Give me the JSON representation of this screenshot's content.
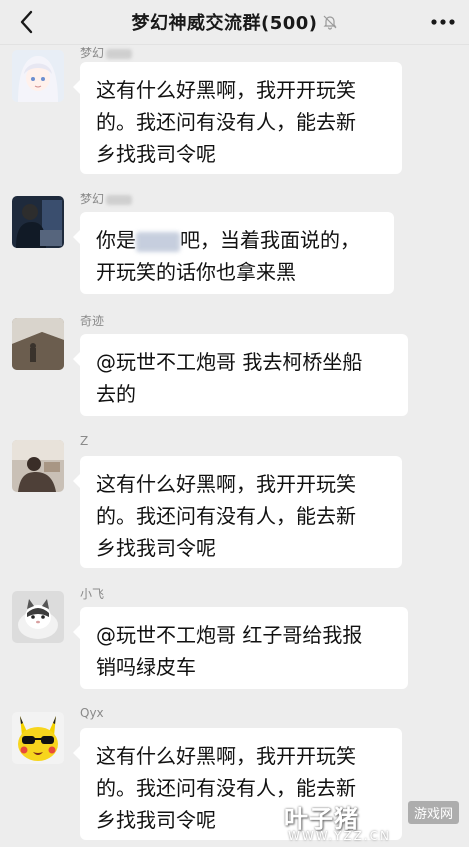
{
  "header": {
    "title": "梦幻神威交流群(500)",
    "back_icon": "chevron-left-icon",
    "mute_icon": "bell-off-icon",
    "more_icon": "more-dots-icon"
  },
  "messages": [
    {
      "sender": "梦幻",
      "avatar": "anime-girl-avatar",
      "lines": [
        "这有什么好黑啊，我开开玩笑",
        "的。我还问有没有人，能去新",
        "乡找我司令呢"
      ]
    },
    {
      "sender": "梦幻",
      "avatar": "dark-photo-avatar",
      "lines_a": [
        "你是",
        "吧，当着我面说的，"
      ],
      "line_b": "开玩笑的话你也拿来黑"
    },
    {
      "sender": "奇迹",
      "avatar": "landscape-avatar",
      "lines": [
        "@玩世不工炮哥 我去柯桥坐船",
        "去的"
      ]
    },
    {
      "sender": "Z",
      "avatar": "person-photo-avatar",
      "lines": [
        "这有什么好黑啊，我开开玩笑",
        "的。我还问有没有人，能去新",
        "乡找我司令呢"
      ]
    },
    {
      "sender": "小飞",
      "avatar": "cat-avatar",
      "lines": [
        "@玩世不工炮哥 红子哥给我报",
        "销吗绿皮车"
      ]
    },
    {
      "sender": "Qyx",
      "avatar": "pikachu-sunglasses-avatar",
      "lines": [
        "这有什么好黑啊，我开开玩笑",
        "的。我还问有没有人，能去新",
        "乡找我司令呢"
      ]
    }
  ],
  "watermark": {
    "brand": "叶子猪",
    "tag": "游戏网",
    "url": "WWW.YZZ.CN"
  }
}
